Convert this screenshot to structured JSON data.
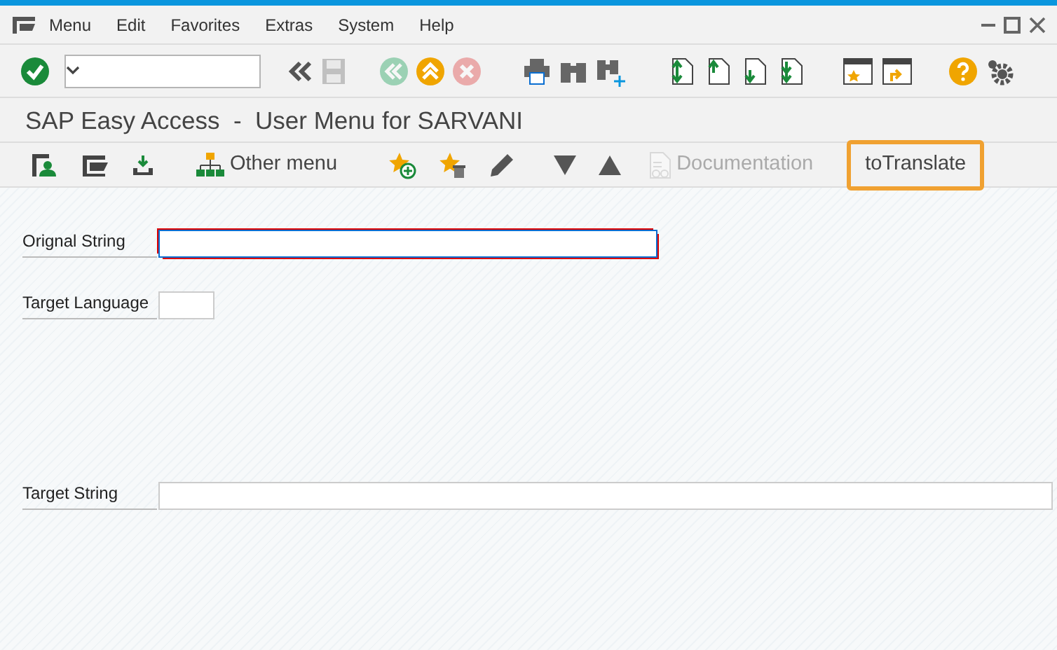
{
  "menu_bar": {
    "items": [
      {
        "label": "Menu"
      },
      {
        "label": "Edit"
      },
      {
        "label": "Favorites"
      },
      {
        "label": "Extras"
      },
      {
        "label": "System"
      },
      {
        "label": "Help"
      }
    ]
  },
  "toolbar": {
    "buttons": [
      {
        "kind": "enter",
        "disabled": false
      },
      {
        "kind": "back-double",
        "disabled": false
      },
      {
        "kind": "save",
        "disabled": true
      },
      {
        "kind": "back",
        "disabled": true
      },
      {
        "kind": "exit",
        "disabled": false
      },
      {
        "kind": "cancel",
        "disabled": true
      },
      {
        "kind": "print",
        "disabled": false
      },
      {
        "kind": "find",
        "disabled": false
      },
      {
        "kind": "find-next",
        "disabled": false
      },
      {
        "kind": "first-page",
        "disabled": false
      },
      {
        "kind": "prev-page",
        "disabled": false
      },
      {
        "kind": "next-page",
        "disabled": false
      },
      {
        "kind": "last-page",
        "disabled": false
      },
      {
        "kind": "new-session",
        "disabled": false
      },
      {
        "kind": "shortcut",
        "disabled": false
      },
      {
        "kind": "help",
        "disabled": false
      },
      {
        "kind": "settings",
        "disabled": false
      }
    ]
  },
  "title": "SAP Easy Access  -  User Menu for SARVANI",
  "app_toolbar": [
    {
      "kind": "user-menu",
      "disabled": false,
      "focused": false
    },
    {
      "kind": "sap-menu",
      "disabled": false,
      "focused": false
    },
    {
      "kind": "download",
      "disabled": false,
      "focused": false
    },
    {
      "kind": "tree",
      "label": "Other menu",
      "disabled": false,
      "focused": false
    },
    {
      "kind": "star-add",
      "disabled": false,
      "focused": false
    },
    {
      "kind": "star-delete",
      "disabled": false,
      "focused": false
    },
    {
      "kind": "edit",
      "disabled": false,
      "focused": false
    },
    {
      "kind": "down",
      "disabled": false,
      "focused": false
    },
    {
      "kind": "up",
      "disabled": false,
      "focused": false
    },
    {
      "kind": "doc",
      "label": "Documentation",
      "disabled": true,
      "focused": false
    },
    {
      "kind": "text",
      "label": "toTranslate",
      "disabled": false,
      "focused": true
    }
  ],
  "form": {
    "fields": [
      {
        "label": "Orignal String",
        "focused": true
      },
      {
        "label": "Target Language",
        "focused": false
      },
      {
        "label": "Target String",
        "focused": false
      }
    ]
  }
}
